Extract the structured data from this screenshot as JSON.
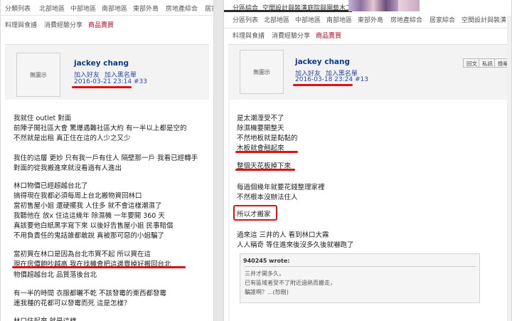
{
  "left": {
    "nav_row1": [
      "分類列表",
      "北部地區",
      "中部地區",
      "南部地區",
      "東部外島",
      "房地產綜合",
      "居家綜合"
    ],
    "nav_row2": [
      "料理與食譜",
      "消費經驗分享",
      "商品賣買"
    ],
    "avatar_text": "無圖示",
    "user_name": "jackey chang",
    "links": [
      "加入好友",
      "加入黑名單"
    ],
    "meta": "2016-03-21 23:14 #33",
    "lines": [
      "我就住 outlet 對面",
      "前陣子開社區大會 驚爆遇難社區大約 有一半以上都是空的",
      "不然就是出租 真正住在這的人少之又少",
      "",
      "我住的這層 更妙 只有我一戶有住人 隔壁那一戶 我看已經轉手",
      "對面的從我搬進來就沒看過有人進出",
      "",
      "林口物價已經超越台北了",
      "搞得現在我都必須每周上台北搬物資回林口",
      "當初售屋小姐 還硬擺我 人住多 就不會這樣潮濕了",
      "我聽他在 放x 住這這幾年 除濕機 一年要開 360 天",
      "真該要他白紙黑字寫下來 以後好告售屋小姐 民事賠償",
      "不用負責任的鬼話誰都敢說 真被那可惡的小姐騙了",
      "",
      "當初買在林口是因為台北市買不起 所以買在這",
      "現在房價飽吵越高 我在找機會把這邊賣掉好搬回台北",
      "物價超越台北 品質落後台北",
      "",
      "有一半的時間 衣服都曬不乾 不該發霉的東西都發霉",
      "連我種的花都可以發霉而死 這是怎樣？",
      "",
      "林口住起來 就是這樣"
    ]
  },
  "right": {
    "nav_row1": [
      "分區列表",
      "北部地區",
      "中部地區",
      "南部地區",
      "東部外島",
      "房地產綜合",
      "居家綜合",
      "空間設計與裝潢",
      "庭院與園藝",
      "木工DIY"
    ],
    "nav_row2": [
      "料理與食譜",
      "消費經驗分享",
      "商品賣買"
    ],
    "avatar_text": "無圖示",
    "user_name": "jackey chang",
    "links": [
      "加入好友",
      "加入黑名單"
    ],
    "meta": "2016-03-18 23:24 #13",
    "buttons": [
      "回文",
      "私訊",
      "檢舉"
    ],
    "lines": [
      "是太潮溼受不了",
      "除濕機要開整天",
      "不然地板就是黏黏的",
      "木板就會翹起來",
      "",
      "整個天花板掉下來",
      "",
      "每過個幾年就要花錢整理家裡",
      "不然根本沒辦法住人",
      "",
      "所以才搬家",
      "",
      "過來這 三井的人 看到林口大霧",
      "人人稱奇 等住進來後沒多久後就嚇跑了"
    ],
    "quote_author": "940245 wrote:",
    "quote_lines": [
      "三井才開多久，",
      "已有區域者受不了附近過熱而搬走，",
      "騙誰啊？...(恕刪)"
    ]
  },
  "top_nav_extra": [
    "分區綜合",
    "空間設計與裝潢",
    "庭院與園藝",
    "木工DIY"
  ]
}
